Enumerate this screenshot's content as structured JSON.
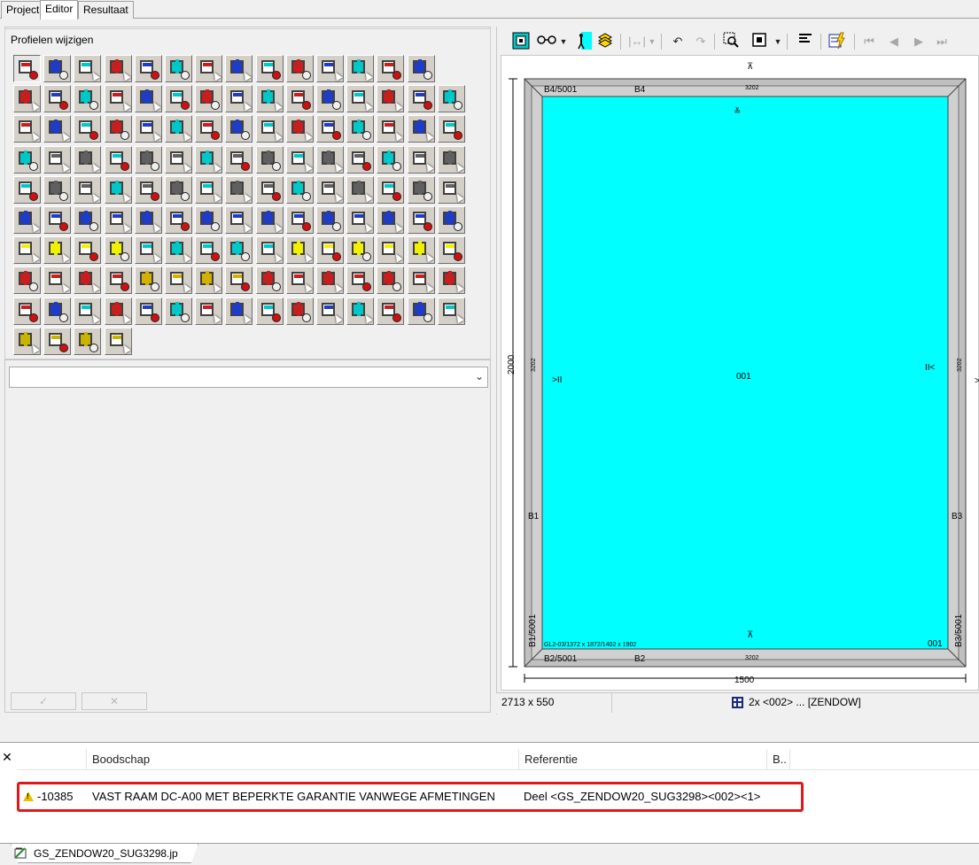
{
  "tabs": [
    "Project",
    "Editor",
    "Resultaat"
  ],
  "active_tab": "Editor",
  "profile_panel": {
    "title": "Profielen wijzigen",
    "combo_value": "",
    "rows": [
      14,
      15,
      15,
      15,
      15,
      15,
      15,
      15,
      15,
      4
    ],
    "apply_button_glyph": "✓",
    "cancel_button_glyph": "✕"
  },
  "toolbar": {
    "icons": [
      "frame-icon",
      "glasses-icon",
      "dropdown-arrow-icon",
      "person-icon",
      "layers-icon",
      "measure-icon",
      "dropdown-arrow-icon",
      "undo-icon",
      "redo-icon",
      "zoom-icon",
      "center-icon",
      "dropdown-arrow-icon",
      "align-icon",
      "check-lightning-icon",
      "first-icon",
      "prev-icon",
      "next-icon",
      "last-icon"
    ]
  },
  "drawing": {
    "dim_height": "2000",
    "dim_width": "1500",
    "pane_label": "001",
    "pane_corner_label": "001",
    "glass_spec": "GL2-03/1372 x 1872/1402 x 1902",
    "profile_codes": {
      "top_left": "B4/5001",
      "top": "B4",
      "top_num": "3202",
      "bottom_left": "B2/5001",
      "bottom": "B2",
      "bottom_num": "3202",
      "left": "B1",
      "left_vert": "B1/5001",
      "left_num": "3202",
      "right": "B3",
      "right_vert": "B3/5001",
      "right_num": "3202"
    },
    "hinge_left": ">II",
    "hinge_right": "II<",
    "opening_top": "⊼",
    "opening_top_inner": "≚",
    "opening_bottom": "⊼",
    "edge_right": ">",
    "fill_color": "#00ffff"
  },
  "status": {
    "size": "2713 x 550",
    "description": "2x <002> ... [ZENDOW]"
  },
  "messages": {
    "columns": [
      "",
      "Boodschap",
      "Referentie",
      "B.."
    ],
    "rows": [
      {
        "code": "-10385",
        "message": "VAST RAAM DC-A00 MET BEPERKTE GARANTIE VANWEGE AFMETINGEN",
        "reference": "Deel <GS_ZENDOW20_SUG3298><002><1>"
      }
    ],
    "close_glyph": "✕"
  },
  "file_tab": "GS_ZENDOW20_SUG3298.jp"
}
